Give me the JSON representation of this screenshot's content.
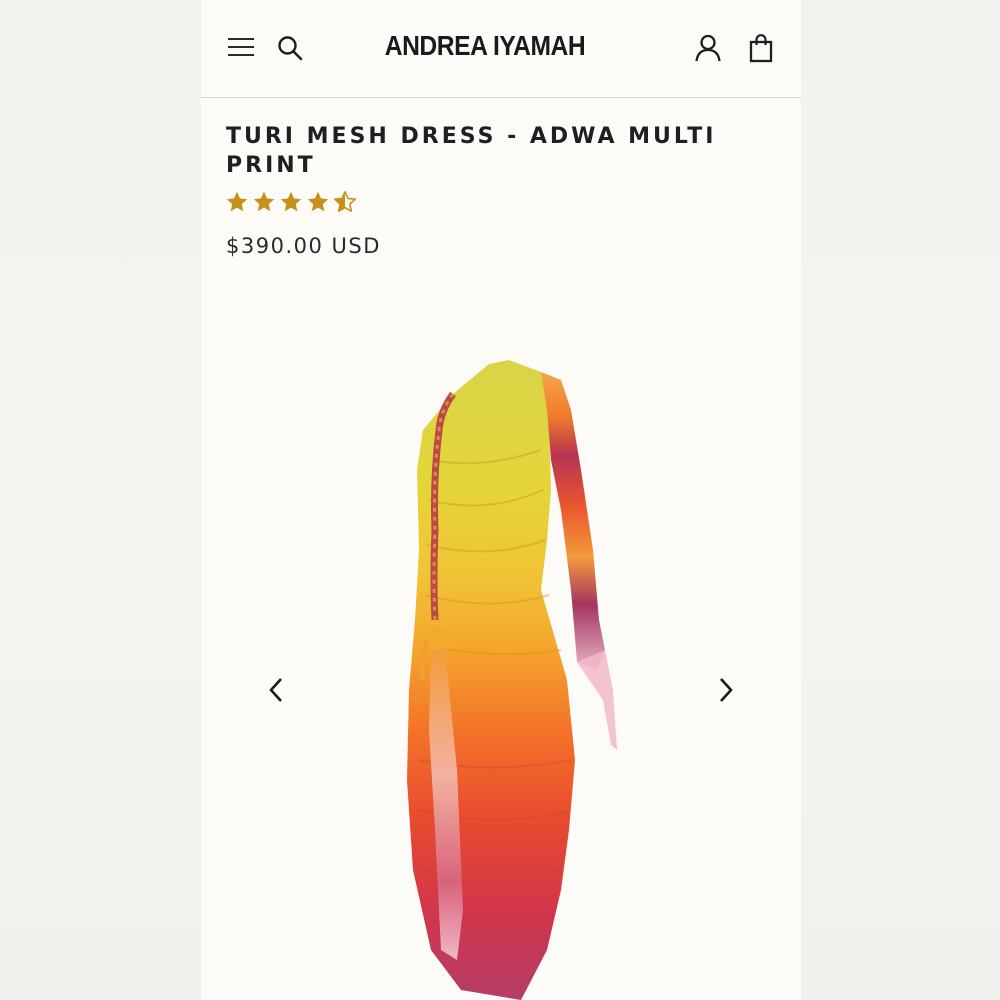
{
  "header": {
    "brand": "ANDREA IYAMAH",
    "menu_icon": "hamburger-menu-icon",
    "search_icon": "search-icon",
    "account_icon": "user-account-icon",
    "cart_icon": "shopping-bag-icon"
  },
  "product": {
    "title": "TURI MESH DRESS - ADWA MULTI PRINT",
    "rating": 4.5,
    "rating_max": 5,
    "price": "$390.00 USD",
    "star_color": "#c8901a"
  },
  "gallery": {
    "prev_icon": "chevron-left-icon",
    "next_icon": "chevron-right-icon",
    "image": "one-shoulder ruched mesh midi dress in yellow-orange-red ombre print"
  }
}
